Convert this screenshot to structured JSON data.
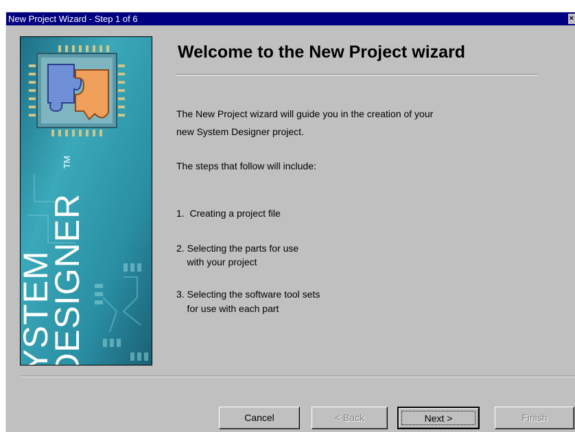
{
  "window": {
    "title": "New Project Wizard - Step 1 of 6",
    "close_glyph": "×"
  },
  "sidebar": {
    "brand_line1": "SYSTEM",
    "brand_line2": "DESIGNER",
    "trademark": "TM"
  },
  "main": {
    "heading": "Welcome to the New Project wizard",
    "intro_line1": "The New Project wizard will guide you in the creation of your",
    "intro_line2": "new System Designer project.",
    "steps_intro": "The steps that follow will include:",
    "step1": "1.  Creating a project file",
    "step2_line1": "2. Selecting the parts for use",
    "step2_line2": "    with your project",
    "step3_line1": "3. Selecting the software tool sets",
    "step3_line2": "    for use with each part"
  },
  "buttons": {
    "cancel": "Cancel",
    "back": "< Back",
    "next": "Next >",
    "finish": "Finish"
  },
  "colors": {
    "titlebar": "#000080",
    "dialog_bg": "#c0c0c0",
    "sidebar_teal": "#2a8fa4"
  }
}
